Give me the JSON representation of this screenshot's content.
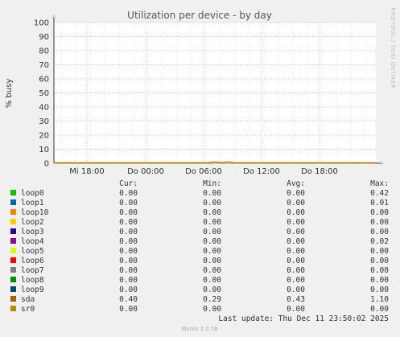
{
  "chart_data": {
    "type": "line",
    "title": "Utilization per device - by day",
    "ylabel": "% busy",
    "xlabel": "",
    "ylim": [
      0,
      100
    ],
    "y_ticks": [
      0,
      10,
      20,
      30,
      40,
      50,
      60,
      70,
      80,
      90,
      100
    ],
    "x_tick_labels": [
      "Mi 18:00",
      "Do 00:00",
      "Do 06:00",
      "Do 12:00",
      "Do 18:00"
    ],
    "grid": true,
    "side_label": "RRDTOOL / TOBI OETIKER",
    "columns": {
      "cur": "Cur:",
      "min": "Min:",
      "avg": "Avg:",
      "max": "Max:"
    },
    "series": [
      {
        "name": "loop0",
        "color": "#00cc00",
        "cur": "0.00",
        "min": "0.00",
        "avg": "0.00",
        "max": "0.42"
      },
      {
        "name": "loop1",
        "color": "#0066b3",
        "cur": "0.00",
        "min": "0.00",
        "avg": "0.00",
        "max": "0.01"
      },
      {
        "name": "loop10",
        "color": "#ff8000",
        "cur": "0.00",
        "min": "0.00",
        "avg": "0.00",
        "max": "0.00"
      },
      {
        "name": "loop2",
        "color": "#ffcc00",
        "cur": "0.00",
        "min": "0.00",
        "avg": "0.00",
        "max": "0.00"
      },
      {
        "name": "loop3",
        "color": "#330099",
        "cur": "0.00",
        "min": "0.00",
        "avg": "0.00",
        "max": "0.00"
      },
      {
        "name": "loop4",
        "color": "#990099",
        "cur": "0.00",
        "min": "0.00",
        "avg": "0.00",
        "max": "0.02"
      },
      {
        "name": "loop5",
        "color": "#ccff00",
        "cur": "0.00",
        "min": "0.00",
        "avg": "0.00",
        "max": "0.00"
      },
      {
        "name": "loop6",
        "color": "#ff0000",
        "cur": "0.00",
        "min": "0.00",
        "avg": "0.00",
        "max": "0.00"
      },
      {
        "name": "loop7",
        "color": "#808080",
        "cur": "0.00",
        "min": "0.00",
        "avg": "0.00",
        "max": "0.00"
      },
      {
        "name": "loop8",
        "color": "#008f00",
        "cur": "0.00",
        "min": "0.00",
        "avg": "0.00",
        "max": "0.00"
      },
      {
        "name": "loop9",
        "color": "#00487d",
        "cur": "0.00",
        "min": "0.00",
        "avg": "0.00",
        "max": "0.00"
      },
      {
        "name": "sda",
        "color": "#b35a00",
        "cur": "0.40",
        "min": "0.29",
        "avg": "0.43",
        "max": "1.10"
      },
      {
        "name": "sr0",
        "color": "#b38f00",
        "cur": "0.00",
        "min": "0.00",
        "avg": "0.00",
        "max": "0.00"
      }
    ],
    "last_update": "Last update: Thu Dec 11 23:50:02 2025",
    "footer": "Munin 2.0.56"
  }
}
